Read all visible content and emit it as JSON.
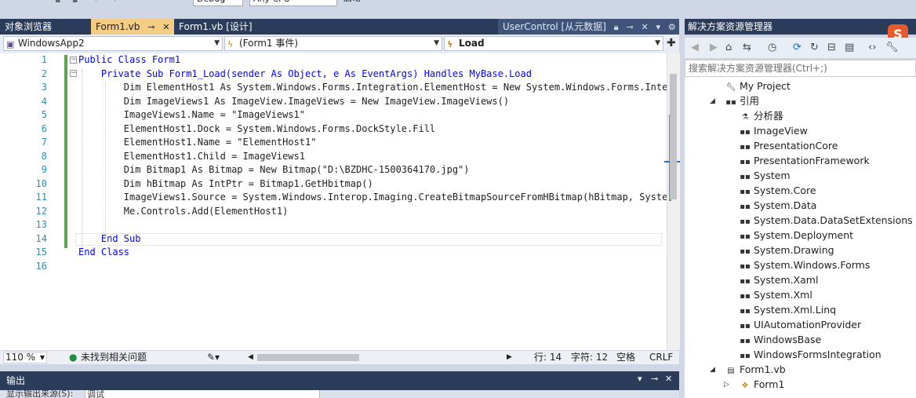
{
  "toolbar": {
    "config": "Debug",
    "platform": "Any CPU",
    "start": "启动"
  },
  "tabs": [
    {
      "label": "对象浏览器"
    },
    {
      "label": "Form1.vb"
    },
    {
      "label": "Form1.vb [设计]"
    },
    {
      "label": "UserControl [从元数据]"
    }
  ],
  "nav": {
    "project": "WindowsApp2",
    "object": "(Form1 事件)",
    "method": "Load"
  },
  "editor": {
    "line_numbers": [
      "1",
      "2",
      "3",
      "4",
      "5",
      "6",
      "7",
      "8",
      "9",
      "10",
      "11",
      "12",
      "13",
      "14",
      "15",
      "16"
    ],
    "code_lines": [
      "Public Class Form1",
      "    Private Sub Form1_Load(sender As Object, e As EventArgs) Handles MyBase.Load",
      "        Dim ElementHost1 As System.Windows.Forms.Integration.ElementHost = New System.Windows.Forms.Inte",
      "        Dim ImageViews1 As ImageView.ImageViews = New ImageView.ImageViews()",
      "        ImageViews1.Name = \"ImageViews1\"",
      "        ElementHost1.Dock = System.Windows.Forms.DockStyle.Fill",
      "        ElementHost1.Name = \"ElementHost1\"",
      "        ElementHost1.Child = ImageViews1",
      "        Dim Bitmap1 As Bitmap = New Bitmap(\"D:\\BZDHC-1500364170.jpg\")",
      "        Dim hBitmap As IntPtr = Bitmap1.GetHbitmap()",
      "        ImageViews1.Source = System.Windows.Interop.Imaging.CreateBitmapSourceFromHBitmap(hBitmap, System",
      "        Me.Controls.Add(ElementHost1)",
      "",
      "    End Sub",
      "End Class",
      ""
    ]
  },
  "status": {
    "zoom": "110 %",
    "issues": "未找到相关问题",
    "line": "行: 14",
    "char": "字符: 12",
    "spaces": "空格",
    "eol": "CRLF"
  },
  "output": {
    "title": "输出",
    "source_label": "显示输出来源(S):",
    "source_value": "调试"
  },
  "solution": {
    "title": "解决方案资源管理器",
    "search_placeholder": "搜索解决方案资源管理器(Ctrl+;)",
    "nodes": [
      {
        "label": "My Project",
        "icon": "wrench-icon"
      },
      {
        "label": "引用",
        "icon": "references-icon"
      },
      {
        "label": "分析器",
        "icon": "analyzer-icon"
      },
      {
        "label": "ImageView",
        "icon": "reference-icon"
      },
      {
        "label": "PresentationCore",
        "icon": "reference-icon"
      },
      {
        "label": "PresentationFramework",
        "icon": "reference-icon"
      },
      {
        "label": "System",
        "icon": "reference-icon"
      },
      {
        "label": "System.Core",
        "icon": "reference-icon"
      },
      {
        "label": "System.Data",
        "icon": "reference-icon"
      },
      {
        "label": "System.Data.DataSetExtensions",
        "icon": "reference-icon"
      },
      {
        "label": "System.Deployment",
        "icon": "reference-icon"
      },
      {
        "label": "System.Drawing",
        "icon": "reference-icon"
      },
      {
        "label": "System.Windows.Forms",
        "icon": "reference-icon"
      },
      {
        "label": "System.Xaml",
        "icon": "reference-icon"
      },
      {
        "label": "System.Xml",
        "icon": "reference-icon"
      },
      {
        "label": "System.Xml.Linq",
        "icon": "reference-icon"
      },
      {
        "label": "UIAutomationProvider",
        "icon": "reference-icon"
      },
      {
        "label": "WindowsBase",
        "icon": "reference-icon"
      },
      {
        "label": "WindowsFormsIntegration",
        "icon": "reference-icon"
      },
      {
        "label": "Form1.vb",
        "icon": "form-file-icon"
      },
      {
        "label": "Form1",
        "icon": "form-class-icon"
      }
    ]
  },
  "badge": {
    "letter": "S"
  },
  "colors": {
    "tab_active": "#f5cc84",
    "chrome_dark": "#2b3c5a",
    "keyword": "#0000ff",
    "type": "#2b91af",
    "string": "#a31515",
    "change_bar": "#57a64a"
  }
}
